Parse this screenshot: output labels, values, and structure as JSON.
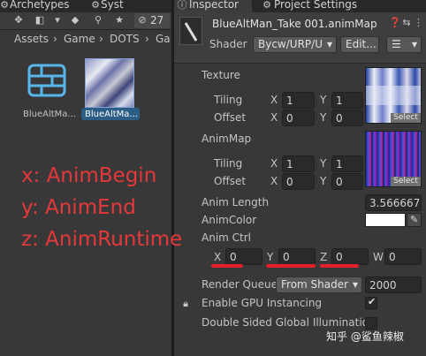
{
  "project_window": {
    "tabs": [
      "Archetypes",
      "Syst"
    ],
    "hidden_count": "27",
    "breadcrumb": [
      "Assets",
      "Game",
      "DOTS",
      "Ga"
    ],
    "assets": [
      {
        "name": "BlueAltMa...",
        "kind": "folder"
      },
      {
        "name": "BlueAltMa...",
        "kind": "texture",
        "selected": true
      }
    ]
  },
  "inspector": {
    "tab_label": "Inspector",
    "second_tab_label": "Project Settings",
    "material_name": "BlueAltMan_Take 001.animMap",
    "shader_label": "Shader",
    "shader_value": "Bycw/URP/U",
    "edit_button": "Edit...",
    "sections": [
      {
        "title": "Texture",
        "tiling_label": "Tiling",
        "offset_label": "Offset",
        "tiling": {
          "x": "1",
          "y": "1"
        },
        "offset": {
          "x": "0",
          "y": "0"
        },
        "select_label": "Select"
      },
      {
        "title": "AnimMap",
        "tiling_label": "Tiling",
        "offset_label": "Offset",
        "tiling": {
          "x": "1",
          "y": "1"
        },
        "offset": {
          "x": "0",
          "y": "0"
        },
        "select_label": "Select"
      }
    ],
    "anim_length_label": "Anim Length",
    "anim_length_value": "3.566667",
    "anim_color_label": "AnimColor",
    "anim_ctrl_label": "Anim Ctrl",
    "anim_ctrl": {
      "x": "0",
      "y": "0",
      "z": "0",
      "w": "0"
    },
    "render_queue_label": "Render Queue",
    "render_queue_mode": "From Shader",
    "render_queue_value": "2000",
    "gpu_instancing_label": "Enable GPU Instancing",
    "double_sided_label": "Double Sided Global Illumination"
  },
  "annotations": [
    "x: AnimBegin",
    "y: AnimEnd",
    "z: AnimRuntime"
  ],
  "watermark": "知乎 @鲨鱼辣椒",
  "colors": {
    "annotation_red": "#e5383b",
    "selection_blue": "#2c5d87",
    "panel_bg": "#383838"
  }
}
